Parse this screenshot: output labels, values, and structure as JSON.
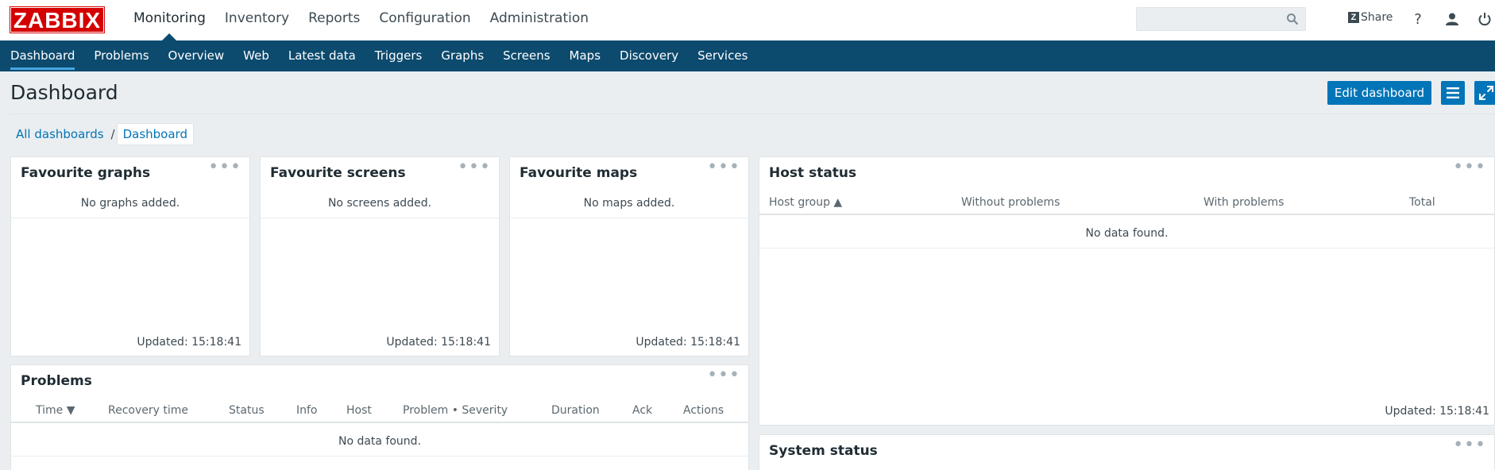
{
  "header": {
    "logo": "ZABBIX",
    "menu": [
      "Monitoring",
      "Inventory",
      "Reports",
      "Configuration",
      "Administration"
    ],
    "search": {
      "value": "",
      "placeholder": ""
    },
    "share_label": "Share",
    "share_badge": "Z",
    "help_label": "?"
  },
  "submenu": [
    "Dashboard",
    "Problems",
    "Overview",
    "Web",
    "Latest data",
    "Triggers",
    "Graphs",
    "Screens",
    "Maps",
    "Discovery",
    "Services"
  ],
  "page": {
    "title": "Dashboard",
    "edit_button": "Edit dashboard"
  },
  "breadcrumb": {
    "parent": "All dashboards",
    "separator": "/",
    "current": "Dashboard"
  },
  "widgets": {
    "fav_graphs": {
      "title": "Favourite graphs",
      "empty": "No graphs added.",
      "updated": "Updated: 15:18:41"
    },
    "fav_screens": {
      "title": "Favourite screens",
      "empty": "No screens added.",
      "updated": "Updated: 15:18:41"
    },
    "fav_maps": {
      "title": "Favourite maps",
      "empty": "No maps added.",
      "updated": "Updated: 15:18:41"
    },
    "host_status": {
      "title": "Host status",
      "columns": [
        "Host group ▲",
        "Without problems",
        "With problems",
        "Total"
      ],
      "empty": "No data found.",
      "updated": "Updated: 15:18:41"
    },
    "problems": {
      "title": "Problems",
      "columns": [
        "Time ▼",
        "Recovery time",
        "Status",
        "Info",
        "Host",
        "Problem • Severity",
        "Duration",
        "Ack",
        "Actions"
      ],
      "empty": "No data found."
    },
    "system_status": {
      "title": "System status"
    },
    "menu_dots": "•••"
  }
}
